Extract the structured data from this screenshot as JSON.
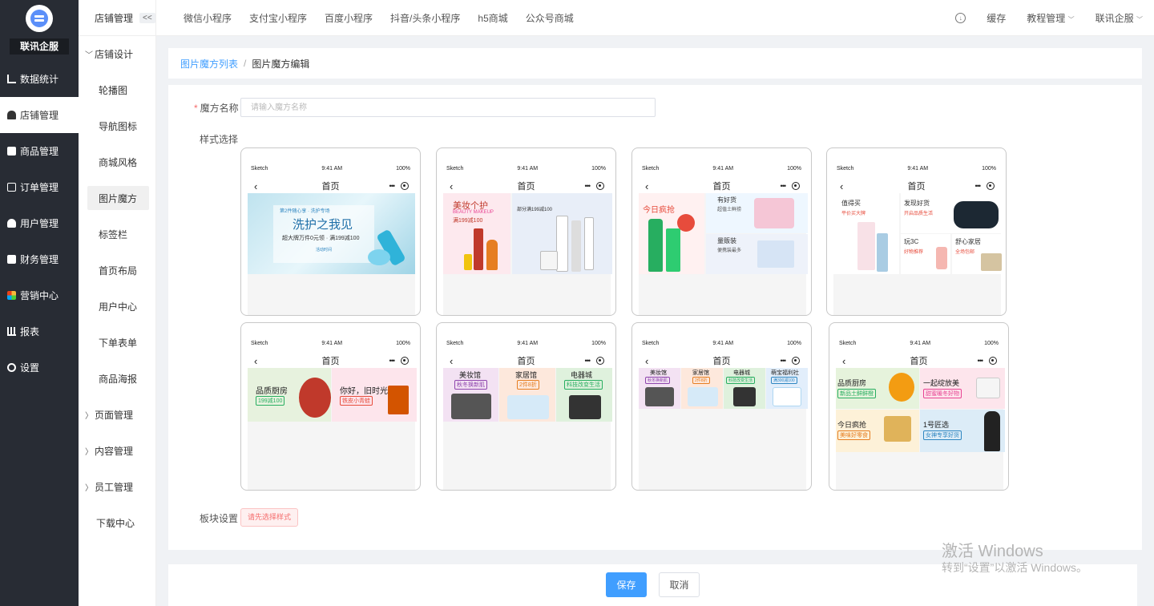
{
  "sidebar": {
    "brand": "联讯企服",
    "items": [
      {
        "label": "数据统计",
        "icon": "line-chart-icon"
      },
      {
        "label": "店铺管理",
        "icon": "store-icon",
        "active": true
      },
      {
        "label": "商品管理",
        "icon": "goods-icon"
      },
      {
        "label": "订单管理",
        "icon": "order-icon"
      },
      {
        "label": "用户管理",
        "icon": "user-icon"
      },
      {
        "label": "财务管理",
        "icon": "finance-icon"
      },
      {
        "label": "营销中心",
        "icon": "marketing-icon"
      },
      {
        "label": "报表",
        "icon": "report-icon"
      },
      {
        "label": "设置",
        "icon": "settings-icon"
      }
    ]
  },
  "subnav": {
    "title": "店铺管理",
    "collapse": "<<",
    "group_design": "店铺设计",
    "design_items": [
      "轮播图",
      "导航图标",
      "商城风格",
      "图片魔方",
      "标签栏",
      "首页布局",
      "用户中心",
      "下单表单",
      "商品海报"
    ],
    "group_page": "页面管理",
    "group_content": "内容管理",
    "group_staff": "员工管理",
    "download": "下载中心"
  },
  "topbar": {
    "tabs": [
      "微信小程序",
      "支付宝小程序",
      "百度小程序",
      "抖音/头条小程序",
      "h5商城",
      "公众号商城"
    ],
    "cache": "缓存",
    "tutorial": "教程管理",
    "account": "联讯企服"
  },
  "breadcrumb": {
    "list": "图片魔方列表",
    "current": "图片魔方编辑"
  },
  "form": {
    "name_label": "魔方名称",
    "name_placeholder": "请输入魔方名称",
    "style_label": "样式选择",
    "block_label": "板块设置",
    "block_warning": "请先选择样式"
  },
  "phone": {
    "carrier": "Sketch",
    "time": "9:41 AM",
    "battery": "100%",
    "title": "首页"
  },
  "templates": {
    "t1": {
      "title": "洗护之我见",
      "subtitle": "超大牌万件0元领 · 满199减100",
      "top": "第2件随心享 · 洗护专场",
      "bottom": "活动时间"
    },
    "t2": {
      "left_title": "美妆个护",
      "left_en": "BEAUTY MAKEUP",
      "left_sub": "满199减100",
      "right_sub": "部分满199减100"
    },
    "t3": {
      "a": "今日疯抢",
      "b": "有好货",
      "b_sub": "超值土鲜捞",
      "c": "量贩装",
      "c_sub": "便携装最多"
    },
    "t4": {
      "a": "值得买",
      "a_sub": "平价买大牌",
      "b": "发现好货",
      "b_sub": "开启品质生活",
      "c": "玩3C",
      "c_sub": "好物推荐",
      "d": "舒心家居",
      "d_sub": "全场包邮"
    },
    "t5": {
      "a": "品质厨房",
      "a_tag": "199减100",
      "b": "你好，旧时光",
      "b_tag": "铁皮小青蛙"
    },
    "t6": {
      "a": "美妆馆",
      "a_tag": "秋冬换新肌",
      "b": "家居馆",
      "b_tag": "2件8折",
      "c": "电器城",
      "c_tag": "科技改变生活"
    },
    "t7": {
      "a": "美妆馆",
      "a_tag": "秋冬换新肌",
      "b": "家居馆",
      "b_tag": "2件8折",
      "c": "电器城",
      "c_tag": "科技改变生活",
      "d": "萌宝福利社",
      "d_tag": "满300减100"
    },
    "t8": {
      "a": "品质厨房",
      "a_tag": "新品土鲜鲜橙",
      "b": "一起绽放美",
      "b_tag": "甜蜜暖冬好物",
      "c": "今日疯抢",
      "c_tag": "美味好零食",
      "d": "1号匠选",
      "d_tag": "女神专享好货"
    }
  },
  "footer": {
    "save": "保存",
    "cancel": "取消"
  },
  "watermark": {
    "line1": "激活 Windows",
    "line2": "转到“设置”以激活 Windows。"
  }
}
